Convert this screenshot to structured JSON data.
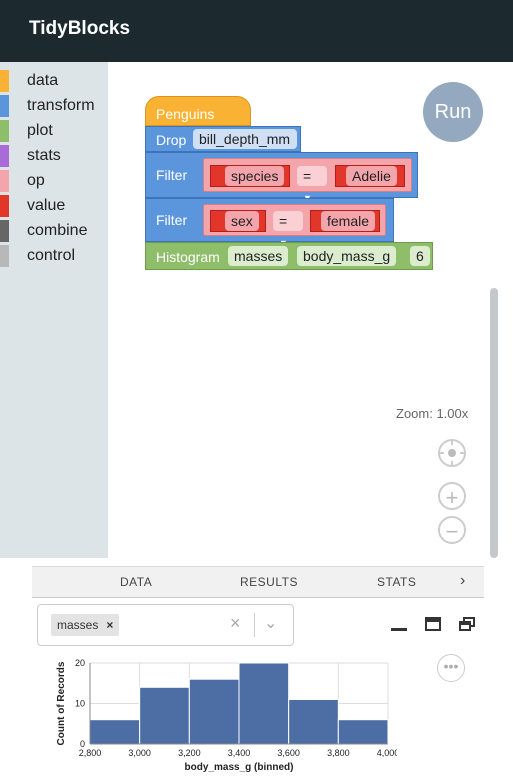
{
  "app": {
    "title": "TidyBlocks"
  },
  "toolbox": {
    "categories": [
      {
        "label": "data",
        "color": "#f9b233"
      },
      {
        "label": "transform",
        "color": "#5b95dc"
      },
      {
        "label": "plot",
        "color": "#8fbe6a"
      },
      {
        "label": "stats",
        "color": "#a86bd8"
      },
      {
        "label": "op",
        "color": "#f4a4ab"
      },
      {
        "label": "value",
        "color": "#e2362a"
      },
      {
        "label": "combine",
        "color": "#666666"
      },
      {
        "label": "control",
        "color": "#b8b8b8"
      }
    ]
  },
  "workspace": {
    "run_label": "Run",
    "zoom_text": "Zoom: 1.00x",
    "blocks": {
      "penguins": "Penguins",
      "drop": {
        "label": "Drop",
        "column": "bill_depth_mm"
      },
      "filter1": {
        "label": "Filter",
        "left": "species",
        "op": "=",
        "right": "Adelie"
      },
      "filter2": {
        "label": "Filter",
        "left": "sex",
        "op": "=",
        "right": "female"
      },
      "histogram": {
        "label": "Histogram",
        "name": "masses",
        "column": "body_mass_g",
        "bins": "6"
      }
    }
  },
  "tabs": [
    "DATA",
    "RESULTS",
    "STATS"
  ],
  "results": {
    "selected": "masses"
  },
  "chart_data": {
    "type": "bar",
    "x_bins": [
      [
        2800,
        3000
      ],
      [
        3000,
        3200
      ],
      [
        3200,
        3400
      ],
      [
        3400,
        3600
      ],
      [
        3600,
        3800
      ],
      [
        3800,
        4000
      ]
    ],
    "values": [
      6,
      14,
      16,
      20,
      11,
      6
    ],
    "xlabel": "body_mass_g (binned)",
    "ylabel": "Count of Records",
    "xticks": [
      "2,800",
      "3,000",
      "3,200",
      "3,400",
      "3,600",
      "3,800",
      "4,000"
    ],
    "yticks": [
      "0",
      "10",
      "20"
    ],
    "xlim": [
      2800,
      4000
    ],
    "ylim": [
      0,
      20
    ],
    "color": "#4c6ea4"
  }
}
